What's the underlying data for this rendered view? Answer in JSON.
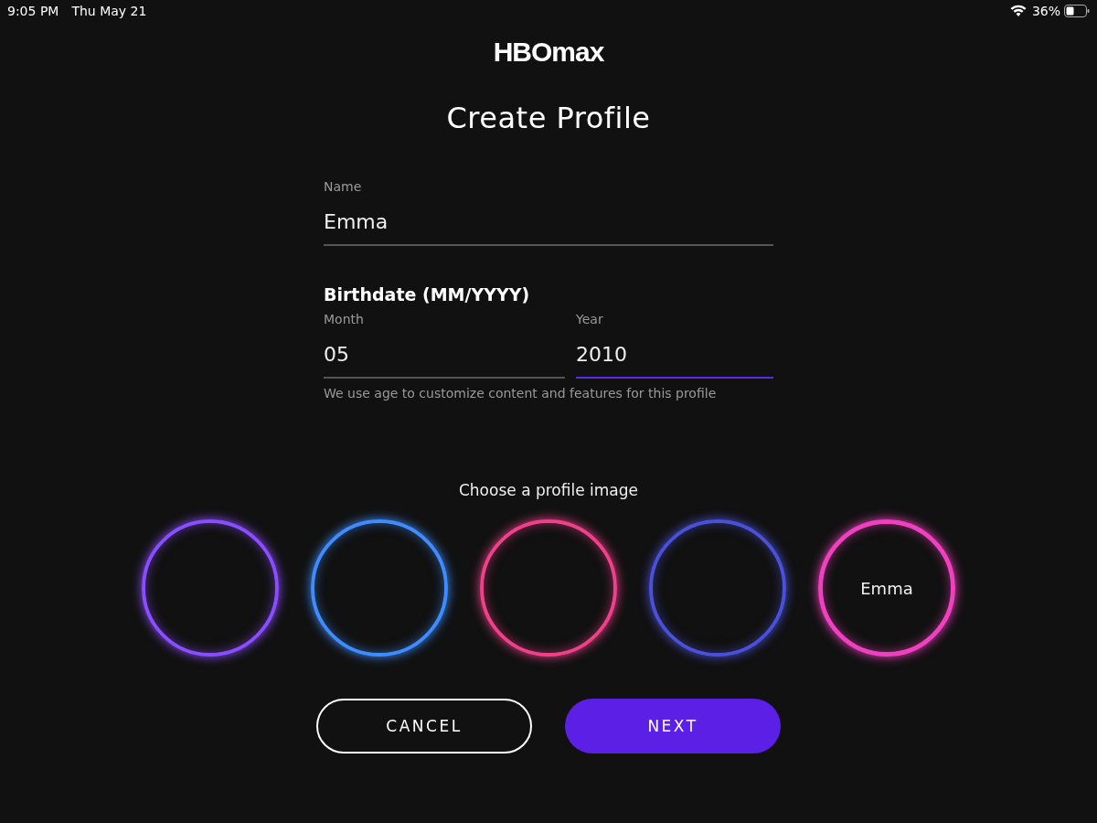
{
  "status_bar": {
    "time": "9:05 PM",
    "date": "Thu May 21",
    "battery": "36%"
  },
  "logo": "HBOmax",
  "title": "Create Profile",
  "name_field": {
    "label": "Name",
    "value": "Emma",
    "focused": false
  },
  "birthdate": {
    "heading": "Birthdate (MM/YYYY)",
    "fields": [
      {
        "label": "Month",
        "value": "05",
        "focused": false
      },
      {
        "label": "Year",
        "value": "2010",
        "focused": true
      }
    ],
    "hint": "We use age to customize content and features for this profile"
  },
  "profile_images": {
    "heading": "Choose a profile image",
    "items": [
      {
        "color": "#8a4dff",
        "selected": false
      },
      {
        "color": "#3f8cff",
        "selected": false
      },
      {
        "color": "#f0408a",
        "selected": false
      },
      {
        "color": "#4a50d8",
        "selected": false
      },
      {
        "color": "#f040c0",
        "selected": true,
        "label": "Emma"
      }
    ]
  },
  "buttons": [
    {
      "kind": "outline",
      "label": "CANCEL"
    },
    {
      "kind": "primary",
      "label": "NEXT"
    }
  ]
}
